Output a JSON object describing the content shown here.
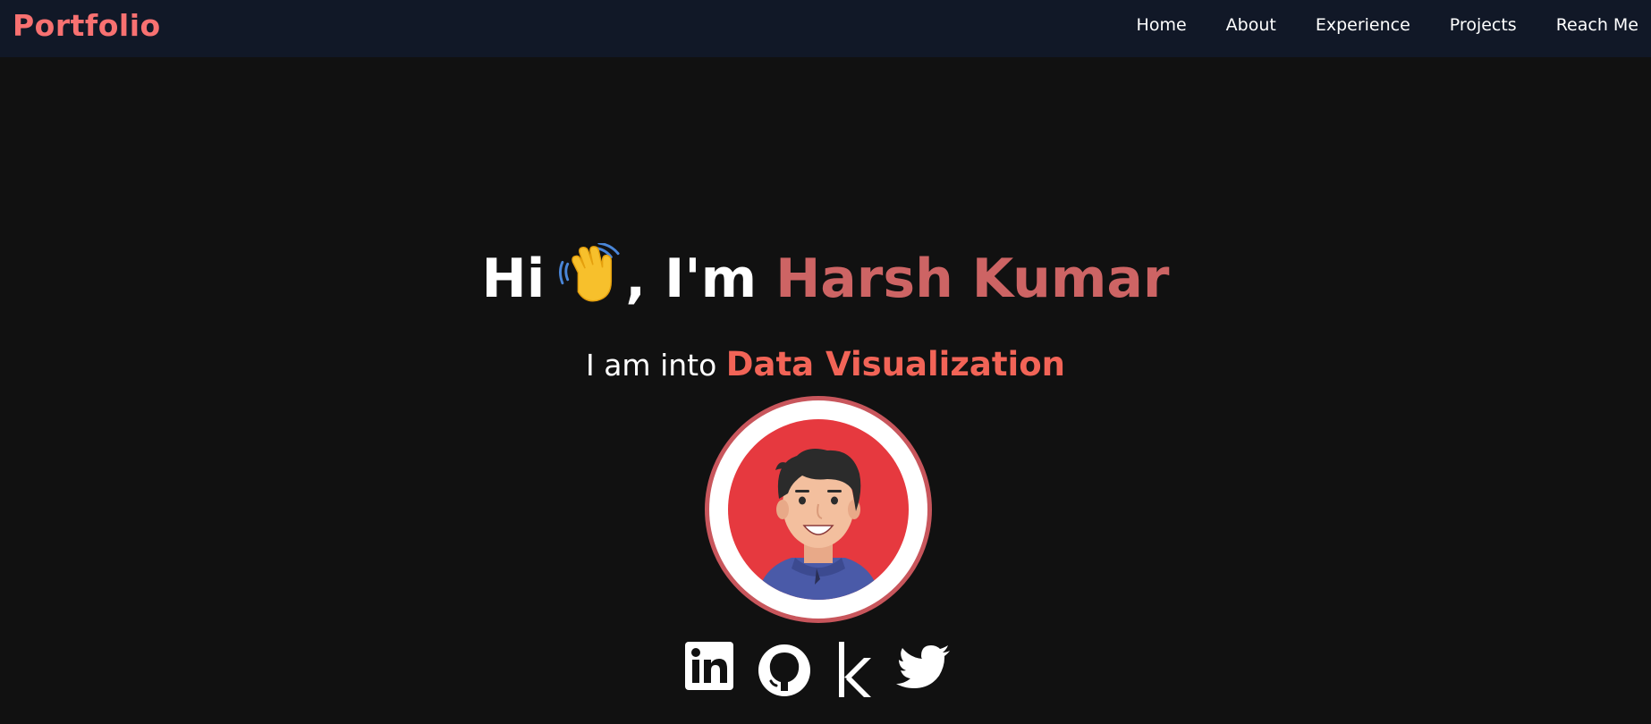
{
  "nav": {
    "brand": "Portfolio",
    "links": [
      "Home",
      "About",
      "Experience",
      "Projects",
      "Reach Me"
    ]
  },
  "hero": {
    "greeting": "Hi",
    "intro": ", I'm",
    "name": "Harsh Kumar",
    "subtitle_prefix": "I am into",
    "role": "Data Visualization"
  },
  "socials": [
    "linkedin-icon",
    "github-icon",
    "kaggle-icon",
    "twitter-icon"
  ],
  "colors": {
    "background": "#111111",
    "navbar": "#111827",
    "brand": "#f87171",
    "name_accent": "#cd6464",
    "role_accent": "#f26457",
    "avatar_ring": "#c8565c",
    "avatar_fill": "#e6393f"
  }
}
